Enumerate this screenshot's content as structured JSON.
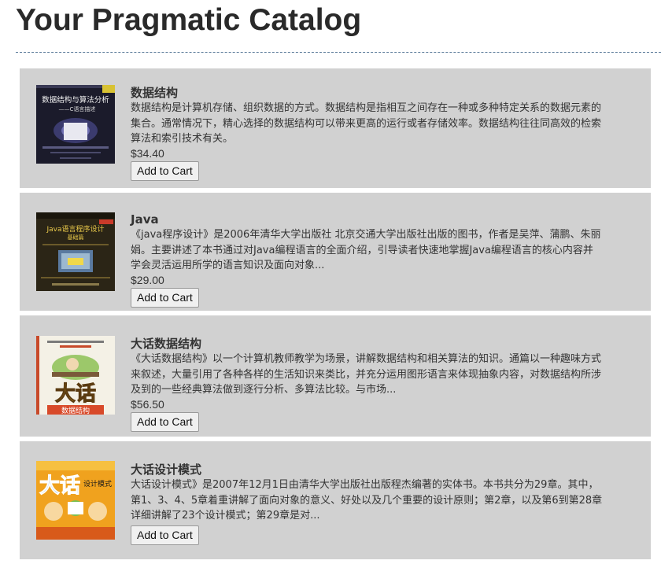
{
  "page": {
    "title": "Your Pragmatic Catalog"
  },
  "products": [
    {
      "title": "数据结构",
      "description": "数据结构是计算机存储、组织数据的方式。数据结构是指相互之间存在一种或多种特定关系的数据元素的集合。通常情况下，精心选择的数据结构可以带来更高的运行或者存储效率。数据结构往往同高效的检索算法和索引技术有关。",
      "price": "$34.40",
      "button": "Add to Cart",
      "cover": {
        "main": "数据结构与算法分析",
        "sub": "——C语言描述",
        "bg": "#1b1b2b"
      }
    },
    {
      "title": "Java",
      "description": "《java程序设计》是2006年清华大学出版社 北京交通大学出版社出版的图书，作者是吴萍、蒲鹏、朱丽娟。主要讲述了本书通过对Java编程语言的全面介绍，引导读者快速地掌握Java编程语言的核心内容并学会灵活运用所学的语言知识及面向对象...",
      "price": "$29.00",
      "button": "Add to Cart",
      "cover": {
        "main": "Java语言程序设计",
        "sub": "基础篇",
        "bg": "#2b2516"
      }
    },
    {
      "title": "大话数据结构",
      "description": "《大话数据结构》以一个计算机教师教学为场景，讲解数据结构和相关算法的知识。通篇以一种趣味方式来叙述，大量引用了各种各样的生活知识来类比，并充分运用图形语言来体现抽象内容，对数据结构所涉及到的一些经典算法做到逐行分析、多算法比较。与市场...",
      "price": "$56.50",
      "button": "Add to Cart",
      "cover": {
        "main": "大话",
        "sub": "数据结构",
        "bg": "#f4f1e6"
      }
    },
    {
      "title": "大话设计模式",
      "description": "大话设计模式》是2007年12月1日由清华大学出版社出版程杰编著的实体书。本书共分为29章。其中，第1、3、4、5章着重讲解了面向对象的意义、好处以及几个重要的设计原则；第2章，以及第6到第28章详细讲解了23个设计模式；第29章是对...",
      "price": "",
      "button": "Add to Cart",
      "cover": {
        "main": "大话",
        "sub": "设计模式",
        "bg": "#f0a21e"
      }
    }
  ]
}
